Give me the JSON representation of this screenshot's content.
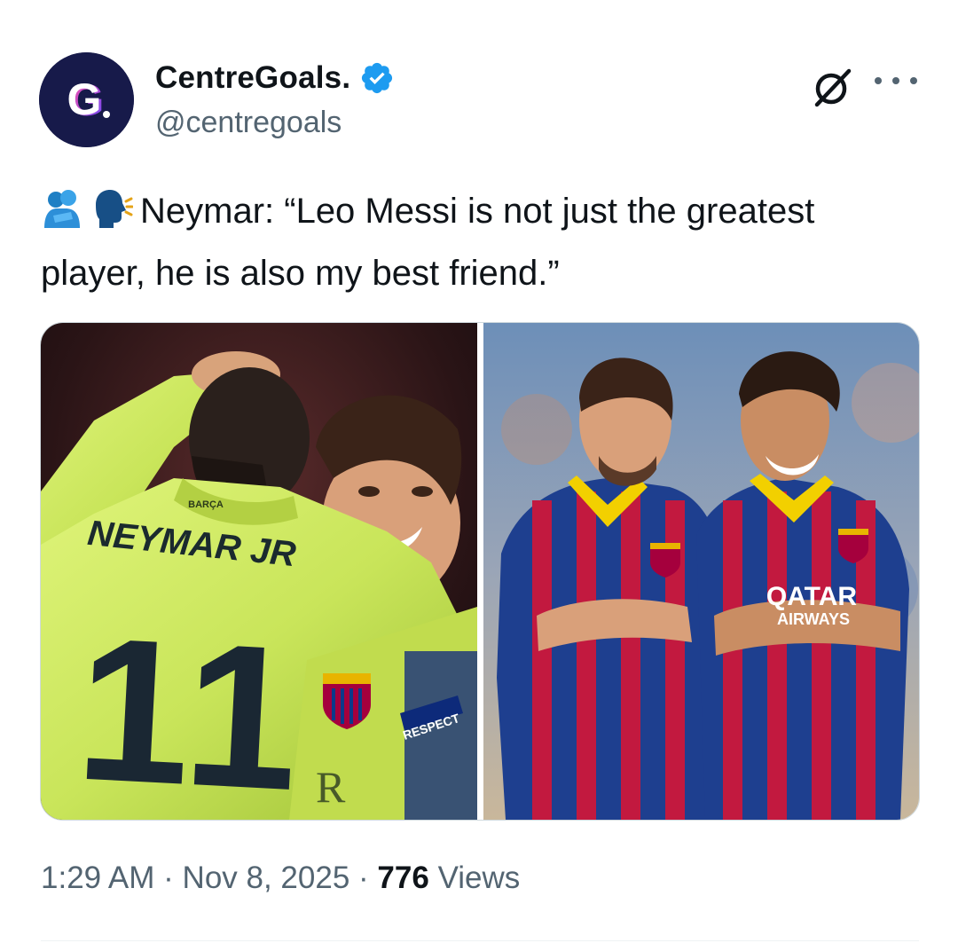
{
  "author": {
    "display_name": "CentreGoals.",
    "handle": "@centregoals",
    "avatar_letter": "G",
    "verified": true
  },
  "tweet": {
    "emojis": [
      "people-hugging-icon",
      "speaking-head-icon"
    ],
    "text": "Neymar: “Leo Messi is not just the greatest player, he is also my best friend.”"
  },
  "media": {
    "left_photo": {
      "jersey_name": "NEYMAR JR",
      "jersey_number": "11",
      "collar_text": "BARÇA",
      "sleeve_text": "RESPECT"
    },
    "right_photo": {
      "sponsor_line1": "QATAR",
      "sponsor_line2": "AIRWAYS"
    }
  },
  "meta": {
    "time": "1:29 AM",
    "separator": "·",
    "date": "Nov 8, 2025",
    "views_count": "776",
    "views_label": "Views"
  },
  "colors": {
    "accent": "#1d9bf0",
    "text_primary": "#0f1419",
    "text_secondary": "#536471",
    "avatar_bg": "#171a4a"
  }
}
